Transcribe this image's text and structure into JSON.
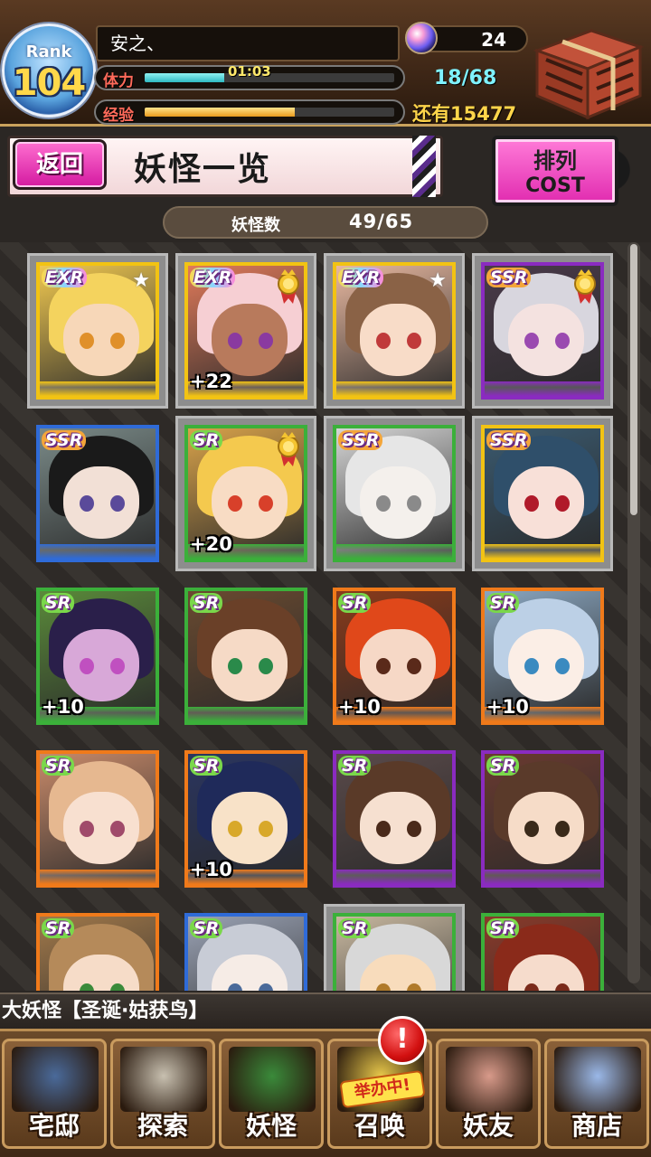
{
  "player": {
    "rank_label": "Rank",
    "rank": "104",
    "name": "安之、",
    "stamina_label": "体力",
    "stamina_timer": "01:03",
    "stamina_fill": 0.32,
    "stamina_count": "18/68",
    "exp_label": "经验",
    "exp_fill": 0.6,
    "remaining_exp": "还有15477",
    "gems": "24"
  },
  "header": {
    "back_label": "返回",
    "title": "妖怪一览",
    "sort_top": "排列",
    "sort_bottom": "COST"
  },
  "count": {
    "label": "妖怪数",
    "value": "49/65"
  },
  "cards": [
    {
      "rarity": "EXR",
      "plus": "",
      "badge": "star",
      "border": "#f2c313",
      "hair": "#f4d35e",
      "skin": "#f7d7b8",
      "eye": "#e0902a",
      "bg": "#f0c850",
      "base": "#f2c313"
    },
    {
      "rarity": "EXR",
      "plus": "+22",
      "badge": "medal",
      "border": "#f2c313",
      "hair": "#f6cfd3",
      "skin": "#b87a5c",
      "eye": "#8a3aa0",
      "bg": "#e07a5a",
      "base": "#f2c313"
    },
    {
      "rarity": "EXR",
      "plus": "",
      "badge": "star",
      "border": "#f2c313",
      "hair": "#8a6246",
      "skin": "#f8dcc8",
      "eye": "#c03a3a",
      "bg": "#e8b8a0",
      "base": "#f2c313"
    },
    {
      "rarity": "SSR",
      "plus": "",
      "badge": "medal",
      "border": "#8a2bc0",
      "hair": "#d8d6de",
      "skin": "#f4e2e0",
      "eye": "#9a4ab0",
      "bg": "#4a3a4a",
      "base": "#8a2bc0"
    },
    {
      "rarity": "SSR",
      "plus": "",
      "badge": "",
      "border": "#2f6bd8",
      "hair": "#1a1a1a",
      "skin": "#f2e0d6",
      "eye": "#5a4a9a",
      "bg": "#7a8a88",
      "base": "#2f6bd8"
    },
    {
      "rarity": "SR",
      "plus": "+20",
      "badge": "medal",
      "border": "#3bb03a",
      "hair": "#f4c94e",
      "skin": "#f8dcc4",
      "eye": "#d8402a",
      "bg": "#d8a24a",
      "base": "#3bb03a"
    },
    {
      "rarity": "SSR",
      "plus": "",
      "badge": "",
      "border": "#3bb03a",
      "hair": "#e6e6e6",
      "skin": "#f4f0ec",
      "eye": "#8a8a8a",
      "bg": "#d6d6d6",
      "base": "#3bb03a"
    },
    {
      "rarity": "SSR",
      "plus": "",
      "badge": "",
      "border": "#f2c313",
      "hair": "#2f4f6a",
      "skin": "#f8e0d8",
      "eye": "#b01a2a",
      "bg": "#3a5a70",
      "base": "#f2c313"
    },
    {
      "rarity": "SR",
      "plus": "+10",
      "badge": "",
      "border": "#3bb03a",
      "hair": "#2a1f4a",
      "skin": "#d8a8d8",
      "eye": "#c050c0",
      "bg": "#5a8a3a",
      "base": "#3bb03a"
    },
    {
      "rarity": "SR",
      "plus": "",
      "badge": "",
      "border": "#3bb03a",
      "hair": "#6a4028",
      "skin": "#f6dac6",
      "eye": "#2a8a4a",
      "bg": "#6a4a30",
      "base": "#3bb03a"
    },
    {
      "rarity": "SR",
      "plus": "+10",
      "badge": "",
      "border": "#f07a1a",
      "hair": "#e0481a",
      "skin": "#f6d8c6",
      "eye": "#5a2a1a",
      "bg": "#8a3a1a",
      "base": "#f07a1a"
    },
    {
      "rarity": "SR",
      "plus": "+10",
      "badge": "",
      "border": "#f07a1a",
      "hair": "#bcd0e6",
      "skin": "#fbeee6",
      "eye": "#3a8ac0",
      "bg": "#8aa6c0",
      "base": "#f07a1a"
    },
    {
      "rarity": "SR",
      "plus": "",
      "badge": "",
      "border": "#f07a1a",
      "hair": "#e6b890",
      "skin": "#f8e0d0",
      "eye": "#a04a6a",
      "bg": "#c88a6a",
      "base": "#f07a1a"
    },
    {
      "rarity": "SR",
      "plus": "+10",
      "badge": "",
      "border": "#f07a1a",
      "hair": "#1f2a5a",
      "skin": "#f8e2c8",
      "eye": "#d8a82a",
      "bg": "#2a3560",
      "base": "#f07a1a"
    },
    {
      "rarity": "SR",
      "plus": "",
      "badge": "",
      "border": "#8a2bc0",
      "hair": "#5a3a28",
      "skin": "#f6e0d0",
      "eye": "#4a2a1a",
      "bg": "#5a4a4a",
      "base": "#8a2bc0"
    },
    {
      "rarity": "SR",
      "plus": "",
      "badge": "",
      "border": "#8a2bc0",
      "hair": "#5a3a2a",
      "skin": "#f6dcc8",
      "eye": "#3a2a1a",
      "bg": "#6a3a30",
      "base": "#8a2bc0"
    },
    {
      "rarity": "SR",
      "plus": "",
      "badge": "",
      "border": "#f07a1a",
      "hair": "#b58a5a",
      "skin": "#f6dcc8",
      "eye": "#3a8a3a",
      "bg": "#a0784a",
      "base": "#f07a1a"
    },
    {
      "rarity": "SR",
      "plus": "",
      "badge": "",
      "border": "#2f6bd8",
      "hair": "#c8ccd6",
      "skin": "#f6ece6",
      "eye": "#4a6a9a",
      "bg": "#9aa2b4",
      "base": "#2f6bd8"
    },
    {
      "rarity": "SR",
      "plus": "",
      "badge": "",
      "border": "#3bb03a",
      "hair": "#d8d8d8",
      "skin": "#f8dcbc",
      "eye": "#b07a2a",
      "bg": "#c8b8a0",
      "base": "#3bb03a"
    },
    {
      "rarity": "SR",
      "plus": "",
      "badge": "",
      "border": "#3bb03a",
      "hair": "#8a2a1a",
      "skin": "#f6dccc",
      "eye": "#7a2a1a",
      "bg": "#8a3a2a",
      "base": "#3bb03a"
    }
  ],
  "news": "大妖怪【圣诞·姑获鸟】",
  "nav": [
    {
      "label": "宅邸",
      "pic": "#4a6a9a"
    },
    {
      "label": "探索",
      "pic": "#c8c0b0"
    },
    {
      "label": "妖怪",
      "pic": "#3a8a3a"
    },
    {
      "label": "召唤",
      "pic": "#e8c84a",
      "flag": "举办中!"
    },
    {
      "label": "妖友",
      "pic": "#d89a8a"
    },
    {
      "label": "商店",
      "pic": "#9ab8e8"
    }
  ],
  "alert": "!",
  "colors": {
    "accent_pink": "#e12cb0",
    "stamina": "#2fb9c2",
    "exp": "#e79a1c",
    "rank_gold": "#ffd84a"
  }
}
